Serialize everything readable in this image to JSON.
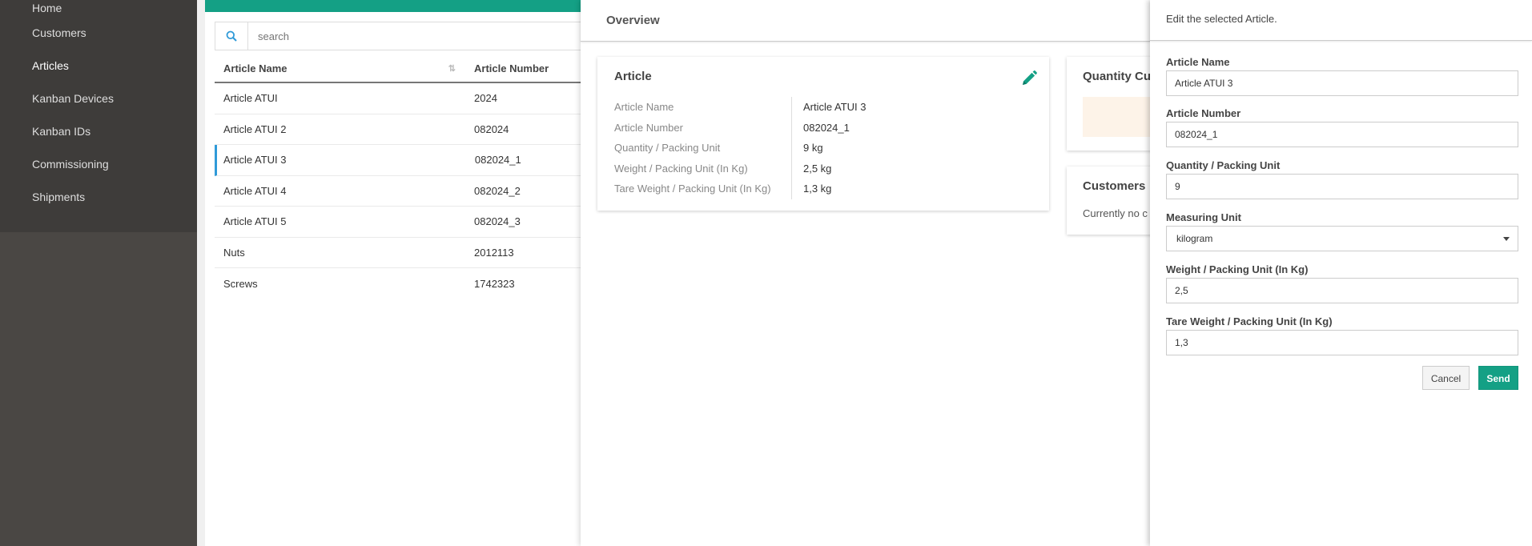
{
  "sidebar": {
    "items": [
      {
        "label": "Home"
      },
      {
        "label": "Customers"
      },
      {
        "label": "Articles"
      },
      {
        "label": "Kanban Devices"
      },
      {
        "label": "Kanban IDs"
      },
      {
        "label": "Commissioning"
      },
      {
        "label": "Shipments"
      }
    ],
    "active": "Articles"
  },
  "list": {
    "search_placeholder": "search",
    "columns": [
      "Article Name",
      "Article Number"
    ],
    "rows": [
      {
        "name": "Article ATUI",
        "number": "2024"
      },
      {
        "name": "Article ATUI 2",
        "number": "082024"
      },
      {
        "name": "Article ATUI 3",
        "number": "082024_1"
      },
      {
        "name": "Article ATUI 4",
        "number": "082024_2"
      },
      {
        "name": "Article ATUI 5",
        "number": "082024_3"
      },
      {
        "name": "Nuts",
        "number": "2012113"
      },
      {
        "name": "Screws",
        "number": "1742323"
      }
    ],
    "selected_row": "Article ATUI 3"
  },
  "overview": {
    "title": "Overview",
    "article_card": {
      "title": "Article",
      "fields": [
        {
          "key": "Article Name",
          "value": "Article ATUI 3"
        },
        {
          "key": "Article Number",
          "value": "082024_1"
        },
        {
          "key": "Quantity / Packing Unit",
          "value": "9 kg"
        },
        {
          "key": "Weight / Packing Unit (In Kg)",
          "value": "2,5 kg"
        },
        {
          "key": "Tare Weight / Packing Unit (In Kg)",
          "value": "1,3 kg"
        }
      ]
    },
    "quantity_card": {
      "title": "Quantity Cu"
    },
    "customers_card": {
      "title": "Customers",
      "text": "Currently no c"
    }
  },
  "edit": {
    "header": "Edit the selected Article.",
    "fields": {
      "article_name": {
        "label": "Article Name",
        "value": "Article ATUI 3"
      },
      "article_number": {
        "label": "Article Number",
        "value": "082024_1"
      },
      "quantity": {
        "label": "Quantity / Packing Unit",
        "value": "9"
      },
      "measuring_unit": {
        "label": "Measuring Unit",
        "value": "kilogram"
      },
      "weight": {
        "label": "Weight / Packing Unit (In Kg)",
        "value": "2,5"
      },
      "tare_weight": {
        "label": "Tare Weight / Packing Unit (In Kg)",
        "value": "1,3"
      }
    },
    "cancel_label": "Cancel",
    "send_label": "Send"
  },
  "colors": {
    "accent": "#14a085",
    "selected_marker": "#2f9ad8",
    "sidebar_bg": "#4a4744"
  }
}
